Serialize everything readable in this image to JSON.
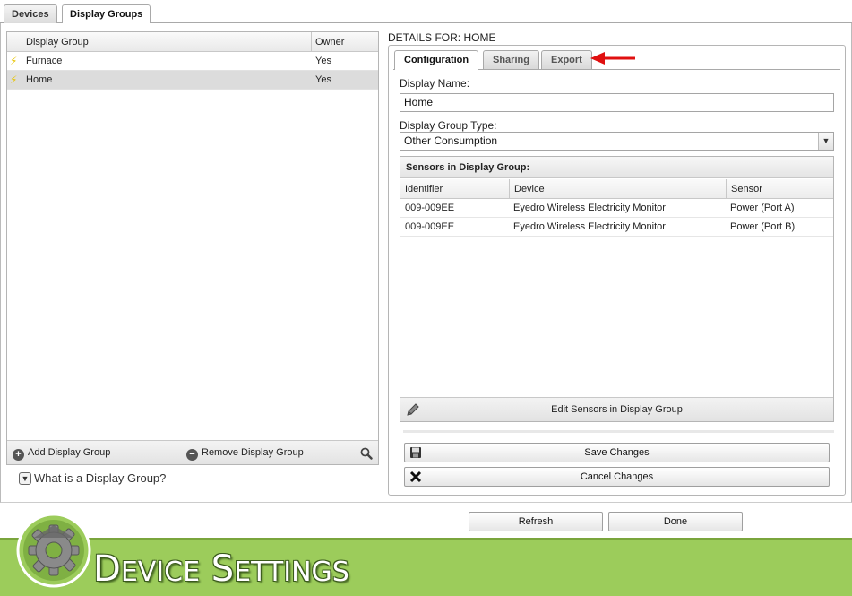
{
  "top_tabs": [
    {
      "label": "Devices",
      "active": false
    },
    {
      "label": "Display Groups",
      "active": true
    }
  ],
  "groups_grid": {
    "columns": [
      "Display Group",
      "Owner"
    ],
    "rows": [
      {
        "name": "Furnace",
        "owner": "Yes",
        "selected": false
      },
      {
        "name": "Home",
        "owner": "Yes",
        "selected": true
      }
    ],
    "footer": {
      "add_label": "Add Display Group",
      "remove_label": "Remove Display Group"
    }
  },
  "help_toggle_label": "What is a Display Group?",
  "details": {
    "title": "DETAILS FOR: HOME",
    "tabs": [
      {
        "label": "Configuration",
        "active": true
      },
      {
        "label": "Sharing",
        "active": false
      },
      {
        "label": "Export",
        "active": false
      }
    ],
    "display_name_label": "Display Name:",
    "display_name_value": "Home",
    "group_type_label": "Display Group Type:",
    "group_type_value": "Other Consumption",
    "sensors": {
      "title": "Sensors in Display Group:",
      "columns": [
        "Identifier",
        "Device",
        "Sensor"
      ],
      "rows": [
        {
          "identifier": "009-009EE",
          "device": "Eyedro Wireless Electricity Monitor",
          "sensor": "Power (Port A)"
        },
        {
          "identifier": "009-009EE",
          "device": "Eyedro Wireless Electricity Monitor",
          "sensor": "Power (Port B)"
        }
      ],
      "edit_label": "Edit Sensors in Display Group"
    },
    "save_label": "Save Changes",
    "cancel_label": "Cancel Changes"
  },
  "bottom_buttons": {
    "refresh_label": "Refresh",
    "done_label": "Done"
  },
  "banner": {
    "title": "Device Settings"
  },
  "colors": {
    "banner_green": "#9ccc5b",
    "arrow_red": "#e01010",
    "bolt_yellow": "#e8c400"
  }
}
